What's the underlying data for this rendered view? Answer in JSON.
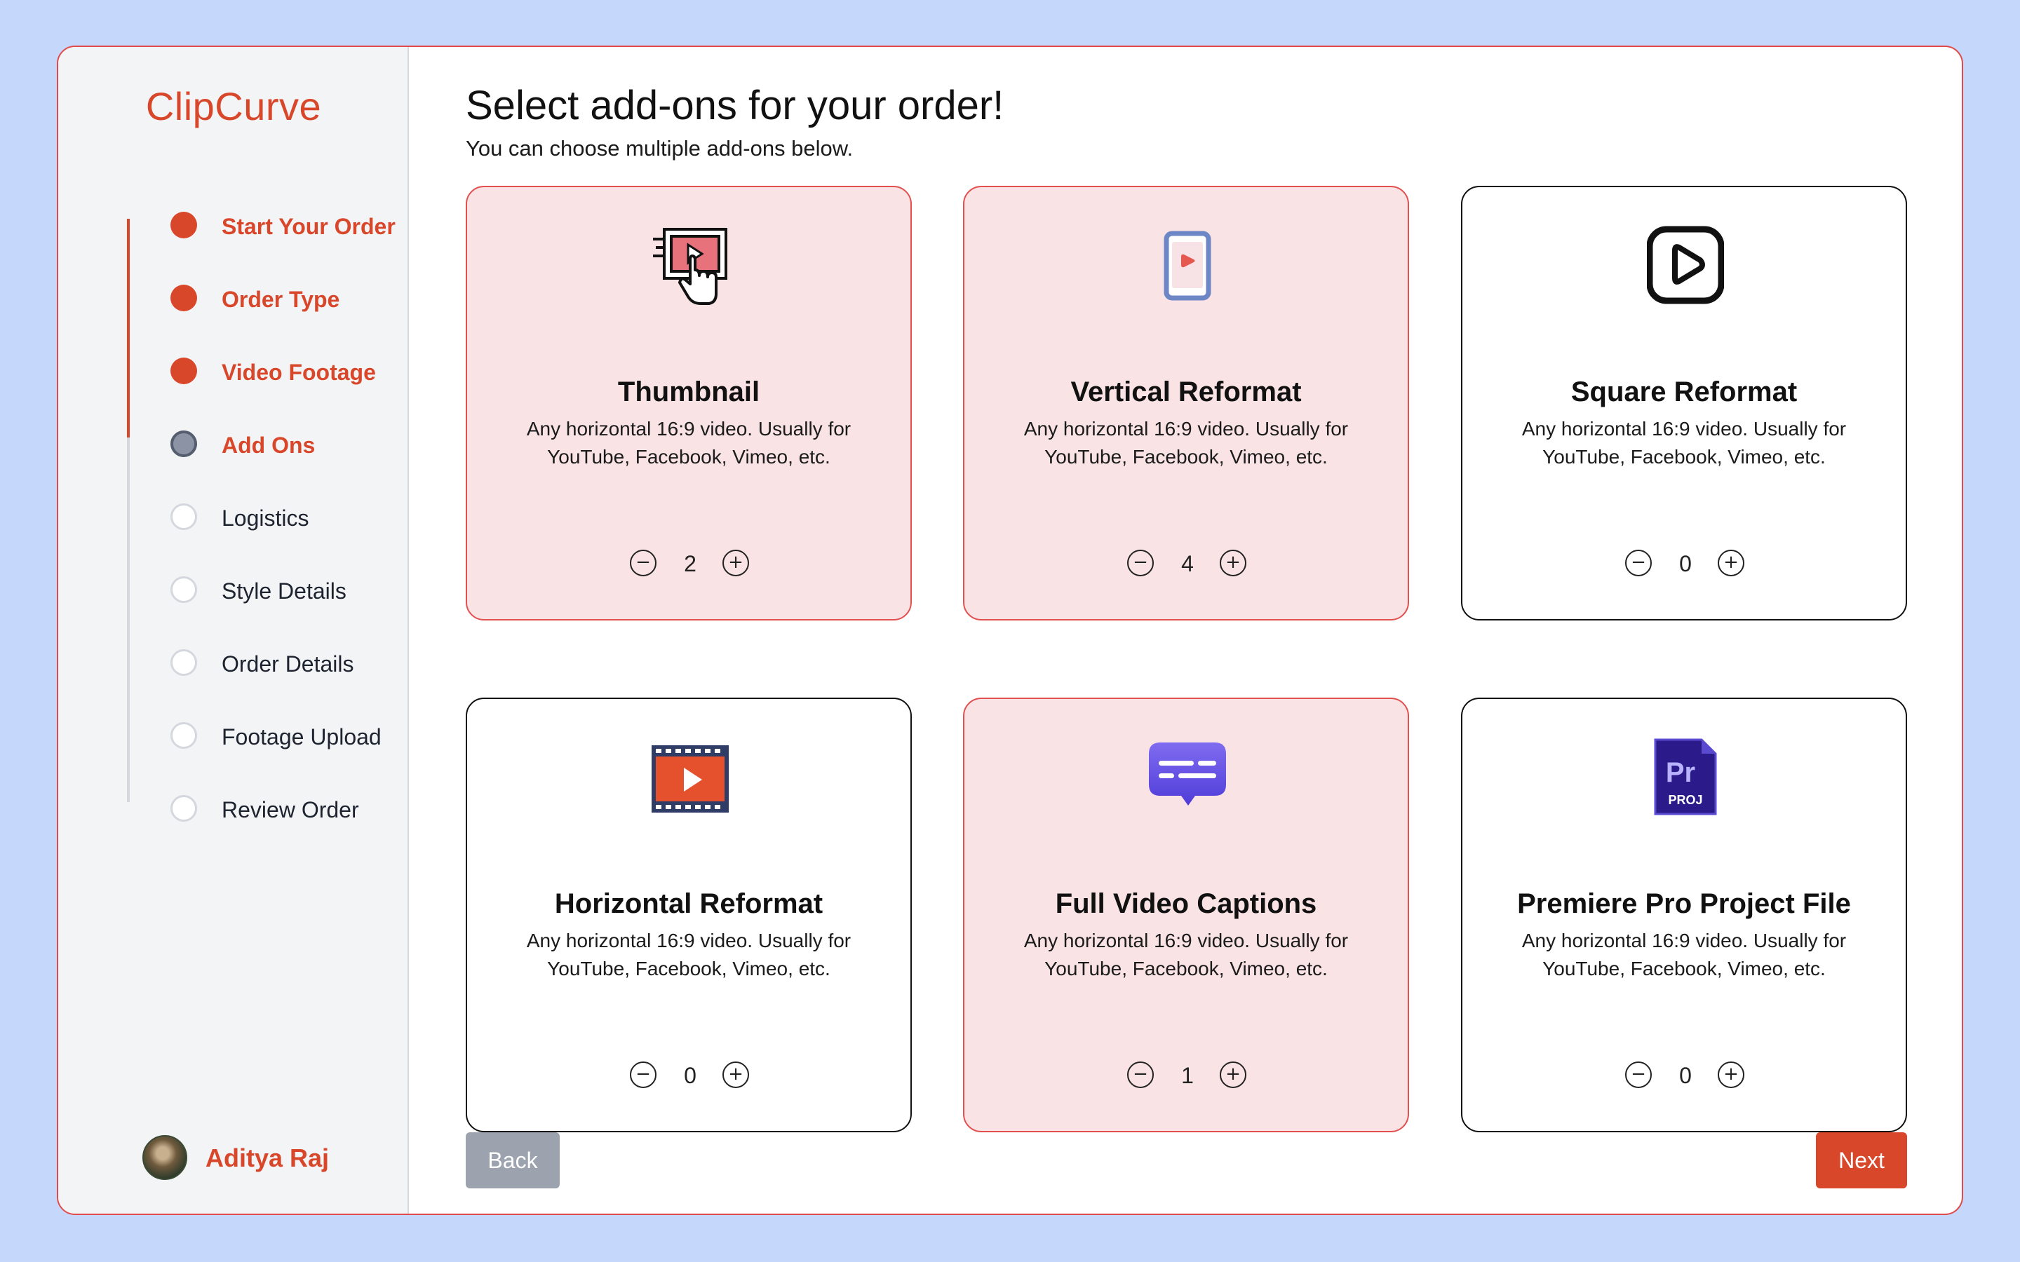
{
  "app": {
    "name": "ClipCurve"
  },
  "steps": [
    {
      "label": "Start Your Order",
      "state": "done"
    },
    {
      "label": "Order Type",
      "state": "done"
    },
    {
      "label": "Video Footage",
      "state": "done"
    },
    {
      "label": "Add Ons",
      "state": "current"
    },
    {
      "label": "Logistics",
      "state": "todo"
    },
    {
      "label": "Style Details",
      "state": "todo"
    },
    {
      "label": "Order Details",
      "state": "todo"
    },
    {
      "label": "Footage Upload",
      "state": "todo"
    },
    {
      "label": "Review Order",
      "state": "todo"
    }
  ],
  "user": {
    "name": "Aditya Raj"
  },
  "header": {
    "title": "Select add-ons for your order!",
    "subtitle": "You can choose multiple add-ons below."
  },
  "addons": [
    {
      "title": "Thumbnail",
      "description": "Any horizontal 16:9 video. Usually for YouTube, Facebook, Vimeo, etc.",
      "quantity": "2",
      "selected": true,
      "icon": "thumbnail-click-icon"
    },
    {
      "title": "Vertical Reformat",
      "description": "Any horizontal 16:9 video. Usually for YouTube, Facebook, Vimeo, etc.",
      "quantity": "4",
      "selected": true,
      "icon": "phone-video-icon"
    },
    {
      "title": "Square Reformat",
      "description": "Any horizontal 16:9 video. Usually for YouTube, Facebook, Vimeo, etc.",
      "quantity": "0",
      "selected": false,
      "icon": "play-square-icon"
    },
    {
      "title": "Horizontal Reformat",
      "description": "Any horizontal 16:9 video. Usually for YouTube, Facebook, Vimeo, etc.",
      "quantity": "0",
      "selected": false,
      "icon": "film-strip-icon"
    },
    {
      "title": "Full Video Captions",
      "description": "Any horizontal 16:9 video. Usually for YouTube, Facebook, Vimeo, etc.",
      "quantity": "1",
      "selected": true,
      "icon": "captions-bubble-icon"
    },
    {
      "title": "Premiere Pro Project File",
      "description": "Any horizontal 16:9 video. Usually for YouTube, Facebook, Vimeo, etc.",
      "quantity": "0",
      "selected": false,
      "icon": "premiere-proj-icon"
    }
  ],
  "stepper_symbols": {
    "minus": "−",
    "plus": "+"
  },
  "premiere_icon_text": {
    "top": "Pr",
    "bottom": "PROJ"
  },
  "nav": {
    "back_label": "Back",
    "next_label": "Next"
  },
  "colors": {
    "accent": "#d9472b",
    "background": "#c5d7fb",
    "selected_card": "#fae3e4",
    "selected_border": "#e35050",
    "back_button": "#9ca3af"
  }
}
